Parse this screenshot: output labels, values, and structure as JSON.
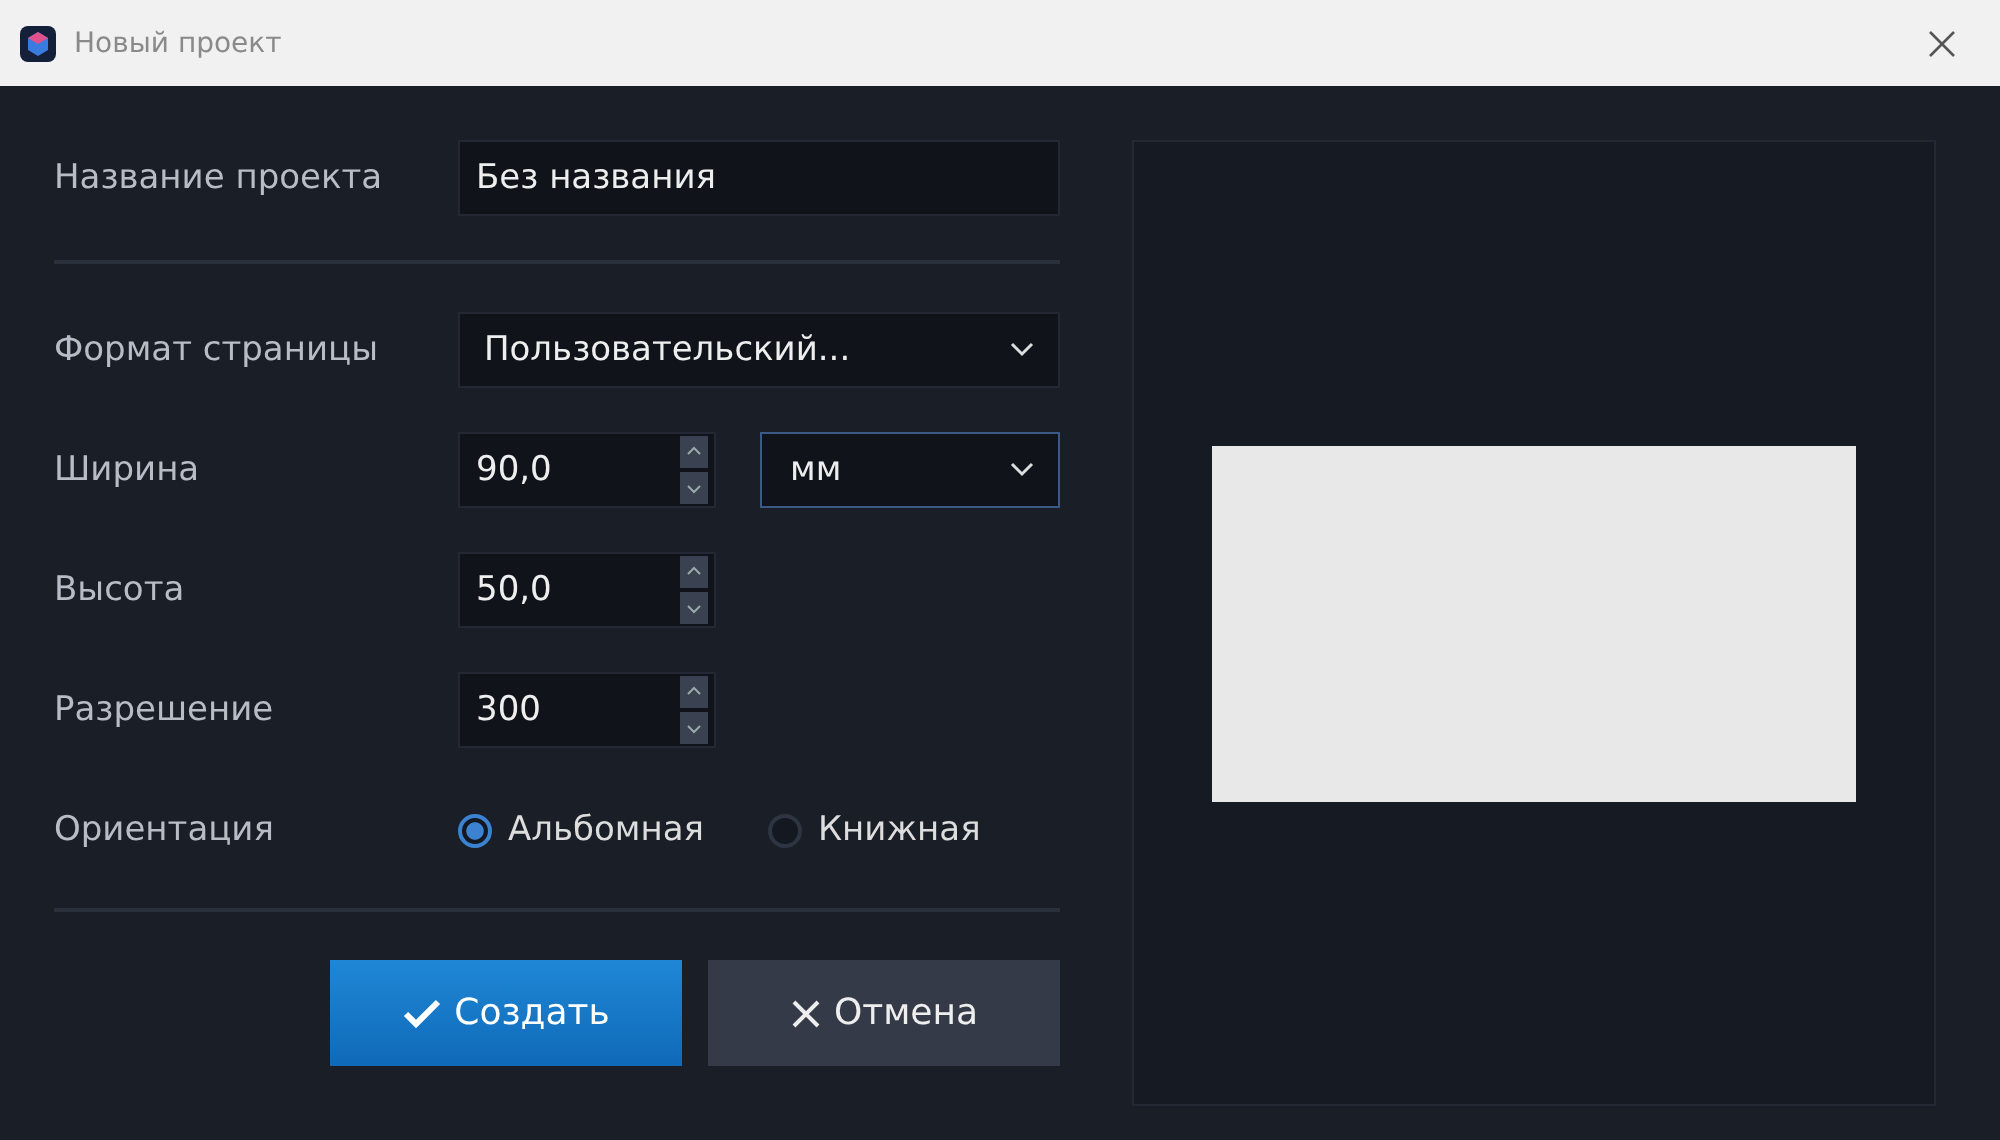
{
  "window": {
    "title": "Новый проект"
  },
  "project_name": {
    "label": "Название проекта",
    "value": "Без названия"
  },
  "page_format": {
    "label": "Формат страницы",
    "value": "Пользовательский..."
  },
  "size_fields": [
    {
      "label": "Ширина",
      "value": "90,0",
      "unit": "мм"
    },
    {
      "label": "Высота",
      "value": "50,0"
    },
    {
      "label": "Разрешение",
      "value": "300"
    }
  ],
  "orientation": {
    "label": "Ориентация",
    "options": [
      {
        "label": "Альбомная",
        "selected": true
      },
      {
        "label": "Книжная",
        "selected": false
      }
    ]
  },
  "buttons": [
    {
      "label": "Создать",
      "kind": "primary"
    },
    {
      "label": "Отмена",
      "kind": "cancel"
    }
  ],
  "preview": {
    "kind": "page"
  }
}
